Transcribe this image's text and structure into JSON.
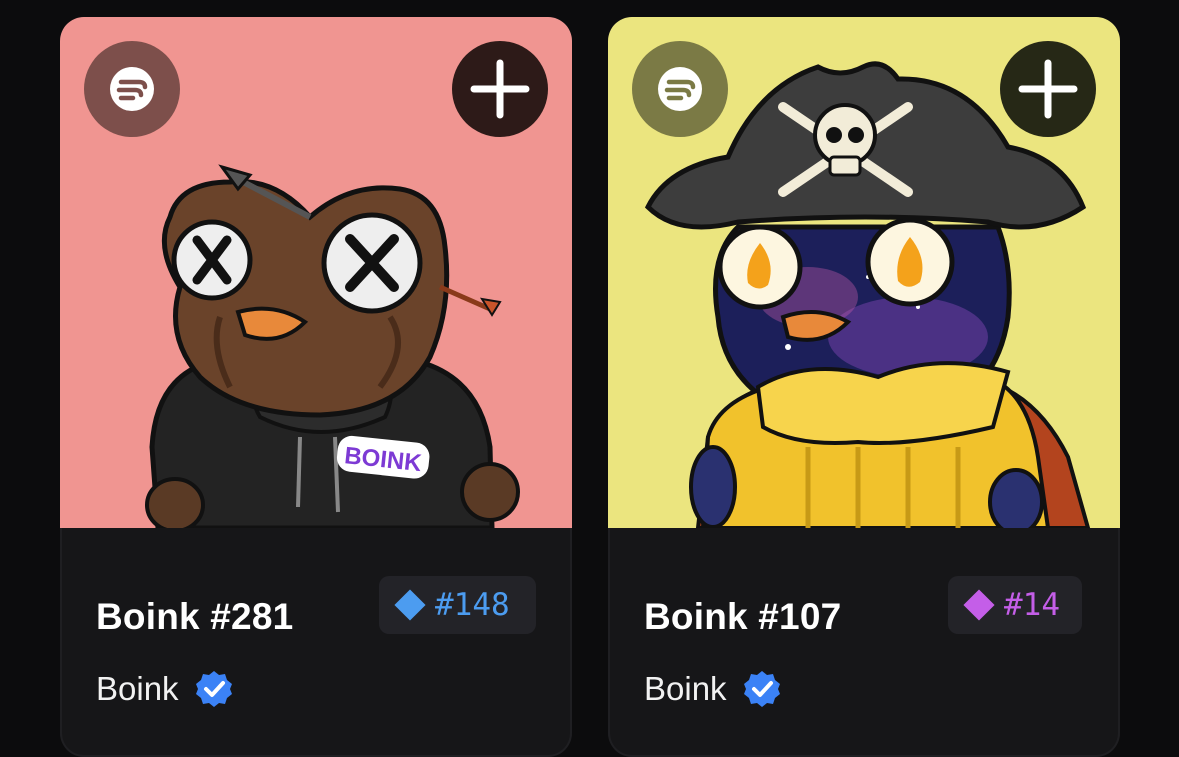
{
  "colors": {
    "page_bg": "#0c0c0d",
    "card_bg": "#161618",
    "left_art_bg": "#f09591",
    "right_art_bg": "#ebe57f",
    "rank_blue": "#4c9cf0",
    "rank_purple": "#c45ee8",
    "verified_blue": "#3b82f6"
  },
  "cards": [
    {
      "title": "Boink #281",
      "rank": "#148",
      "rank_color": "#4c9cf0",
      "collection": "Boink",
      "art_caption": "BOINK",
      "icons": [
        "logo-icon",
        "plus-icon",
        "verified-badge-icon",
        "diamond-icon"
      ]
    },
    {
      "title": "Boink #107",
      "rank": "#14",
      "rank_color": "#c45ee8",
      "collection": "Boink",
      "icons": [
        "logo-icon",
        "plus-icon",
        "verified-badge-icon",
        "diamond-icon"
      ]
    }
  ]
}
